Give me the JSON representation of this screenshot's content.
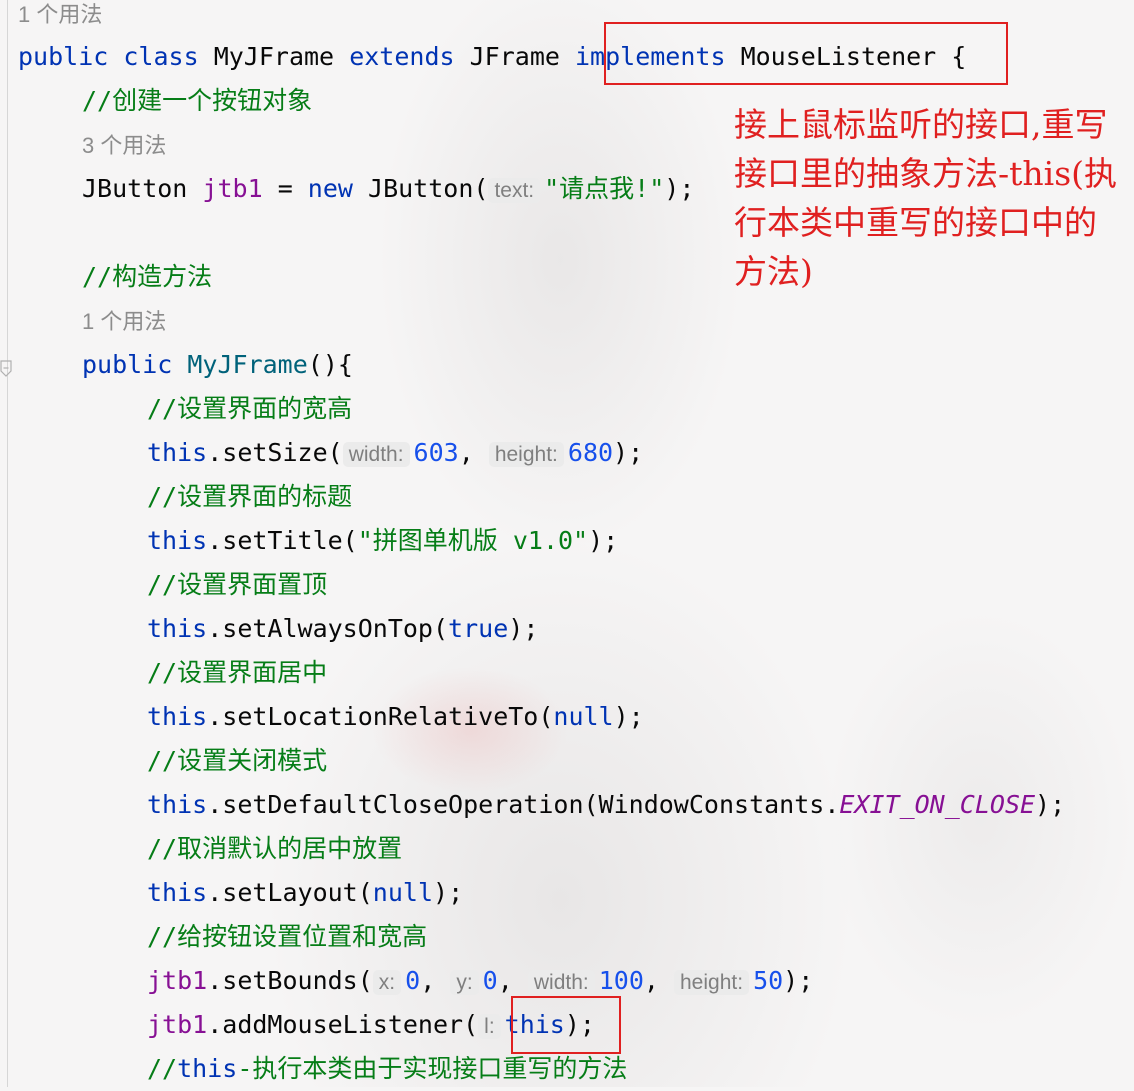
{
  "editor": {
    "usage_1": "1 个用法",
    "class_decl": {
      "kw_public": "public",
      "kw_class": "class",
      "name": "MyJFrame",
      "kw_extends": "extends",
      "super": "JFrame",
      "kw_implements": "implements",
      "iface": "MouseListener",
      "brace": "{"
    },
    "comment_create_button": "//创建一个按钮对象",
    "usage_3": "3 个用法",
    "field_decl": {
      "type": "JButton",
      "name": "jtb1",
      "eq": " = ",
      "kw_new": "new",
      "ctor": "JButton(",
      "hint": "text:",
      "arg": "\"请点我!\"",
      "close": ");"
    },
    "comment_constructor": "//构造方法",
    "usage_1b": "1 个用法",
    "ctor_decl": {
      "kw_public": "public",
      "name": "MyJFrame",
      "rest": "(){"
    },
    "comment_size": "//设置界面的宽高",
    "set_size": {
      "this": "this",
      "call": ".setSize(",
      "hint_w": "width:",
      "w": "603",
      "comma": ",",
      "hint_h": "height:",
      "h": "680",
      "close": ");"
    },
    "comment_title": "//设置界面的标题",
    "set_title": {
      "this": "this",
      "call": ".setTitle(",
      "arg": "\"拼图单机版 v1.0\"",
      "close": ");"
    },
    "comment_top": "//设置界面置顶",
    "set_top": {
      "this": "this",
      "call": ".setAlwaysOnTop(",
      "arg": "true",
      "close": ");"
    },
    "comment_center": "//设置界面居中",
    "set_loc": {
      "this": "this",
      "call": ".setLocationRelativeTo(",
      "arg": "null",
      "close": ");"
    },
    "comment_close": "//设置关闭模式",
    "set_close": {
      "this": "this",
      "call": ".setDefaultCloseOperation(WindowConstants.",
      "arg": "EXIT_ON_CLOSE",
      "close": ");"
    },
    "comment_layout": "//取消默认的居中放置",
    "set_layout": {
      "this": "this",
      "call": ".setLayout(",
      "arg": "null",
      "close": ");"
    },
    "comment_bounds": "//给按钮设置位置和宽高",
    "set_bounds": {
      "obj": "jtb1",
      "call": ".setBounds(",
      "hint_x": "x:",
      "x": "0",
      "hint_y": "y:",
      "y": "0",
      "hint_w": "width:",
      "w": "100",
      "hint_h": "height:",
      "h": "50",
      "comma": ",",
      "close": ");"
    },
    "add_listener": {
      "obj": "jtb1",
      "call": ".addMouseListener(",
      "hint": "l:",
      "arg": "this",
      "close": ");"
    },
    "comment_this": {
      "slashes": "//",
      "this": "this",
      "rest": "-执行本类由于实现接口重写的方法"
    }
  },
  "annotation": {
    "text": "接上鼠标监听的接口,重写接口里的抽象方法-this(执行本类中重写的接口中的方法)",
    "color": "#e02020"
  },
  "colors": {
    "keyword": "#0033b3",
    "comment": "#067d17",
    "number": "#1750eb",
    "field": "#871094",
    "hint_text": "#7f7f7f",
    "highlight_box": "#e02020"
  }
}
